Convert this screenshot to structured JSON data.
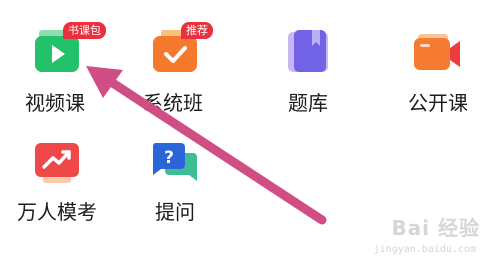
{
  "grid": {
    "items": [
      {
        "label": "视频课",
        "badge": "书课包",
        "icon": "video-play-icon"
      },
      {
        "label": "系统班",
        "badge": "推荐",
        "icon": "checklist-icon"
      },
      {
        "label": "题库",
        "icon": "question-bank-book-icon"
      },
      {
        "label": "公开课",
        "icon": "live-camera-icon"
      },
      {
        "label": "万人模考",
        "icon": "trend-chart-icon"
      },
      {
        "label": "提问",
        "icon": "question-chat-icon"
      }
    ]
  },
  "overlay": {
    "annotation_arrow_color": "#d14e85"
  },
  "watermark": {
    "text": "Bai 经验",
    "subtext": "jingyan.baidu.com"
  }
}
